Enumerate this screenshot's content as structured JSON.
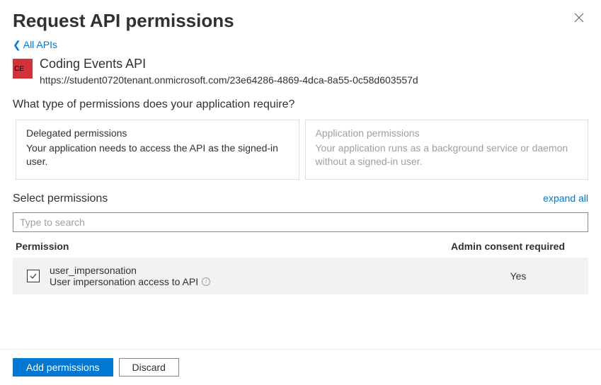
{
  "header": {
    "title": "Request API permissions"
  },
  "back_link": "All APIs",
  "api": {
    "icon_text": "CE",
    "name": "Coding Events API",
    "url": "https://student0720tenant.onmicrosoft.com/23e64286-4869-4dca-8a55-0c58d603557d"
  },
  "question": "What type of permissions does your application require?",
  "perm_types": {
    "delegated": {
      "title": "Delegated permissions",
      "desc": "Your application needs to access the API as the signed-in user."
    },
    "application": {
      "title": "Application permissions",
      "desc": "Your application runs as a background service or daemon without a signed-in user."
    }
  },
  "select_perms": {
    "label": "Select permissions",
    "expand": "expand all"
  },
  "search": {
    "placeholder": "Type to search"
  },
  "table": {
    "col_permission": "Permission",
    "col_admin": "Admin consent required",
    "rows": [
      {
        "checked": true,
        "name": "user_impersonation",
        "desc": "User impersonation access to API",
        "admin_consent": "Yes"
      }
    ]
  },
  "footer": {
    "add": "Add permissions",
    "discard": "Discard"
  }
}
